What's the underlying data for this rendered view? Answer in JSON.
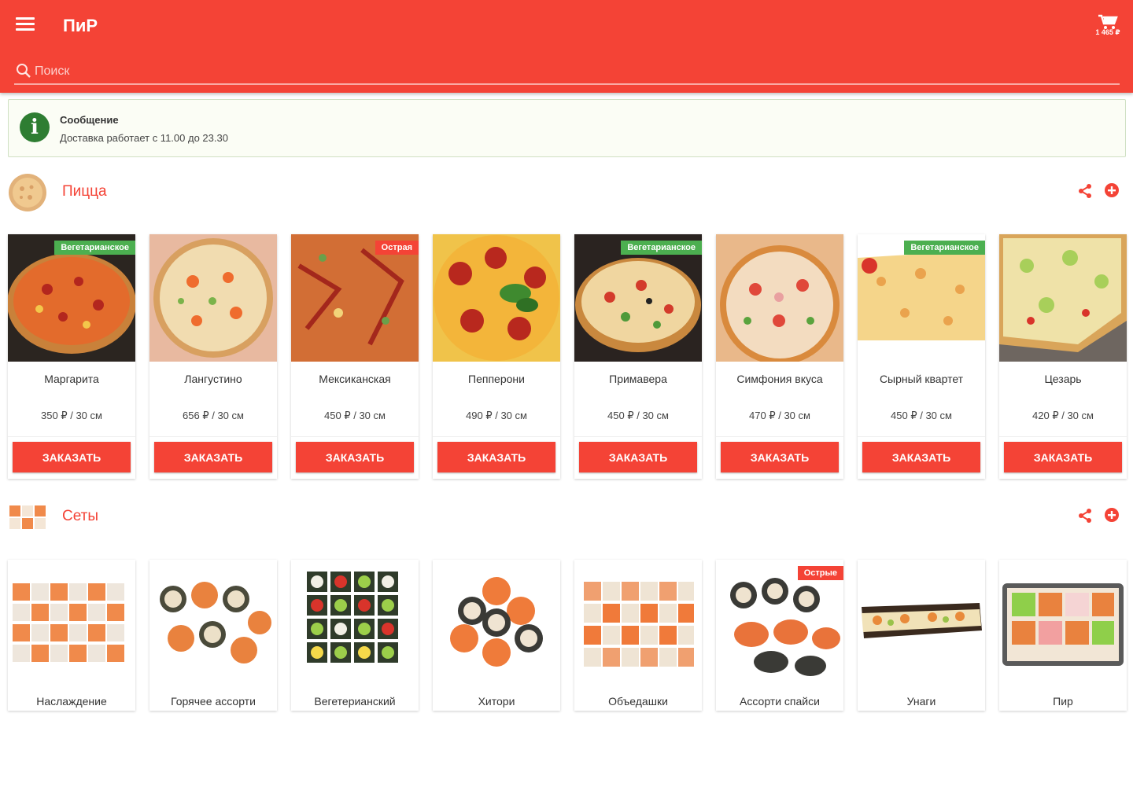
{
  "app": {
    "title": "ПиР",
    "cart_total": "1 465 ₽",
    "accent": "#f44336"
  },
  "search": {
    "placeholder": "Поиск"
  },
  "message": {
    "title": "Сообщение",
    "text": "Доставка работает с 11.00 до 23.30"
  },
  "sections": [
    {
      "title": "Пицца",
      "items": [
        {
          "name": "Маргарита",
          "price": "350 ₽ / 30 см",
          "badge": "Вегетарианское",
          "badge_type": "veg"
        },
        {
          "name": "Лангустино",
          "price": "656 ₽ / 30 см",
          "badge": "",
          "badge_type": ""
        },
        {
          "name": "Мексиканская",
          "price": "450 ₽ / 30 см",
          "badge": "Острая",
          "badge_type": "hot"
        },
        {
          "name": "Пепперони",
          "price": "490 ₽ / 30 см",
          "badge": "",
          "badge_type": ""
        },
        {
          "name": "Примавера",
          "price": "450 ₽ / 30 см",
          "badge": "Вегетарианское",
          "badge_type": "veg"
        },
        {
          "name": "Симфония вкуса",
          "price": "470 ₽ / 30 см",
          "badge": "",
          "badge_type": ""
        },
        {
          "name": "Сырный квартет",
          "price": "450 ₽ / 30 см",
          "badge": "Вегетарианское",
          "badge_type": "veg"
        },
        {
          "name": "Цезарь",
          "price": "420 ₽ / 30 см",
          "badge": "",
          "badge_type": ""
        }
      ]
    },
    {
      "title": "Сеты",
      "items": [
        {
          "name": "Наслаждение",
          "badge": "",
          "badge_type": ""
        },
        {
          "name": "Горячее ассорти",
          "badge": "",
          "badge_type": ""
        },
        {
          "name": "Вегетерианский",
          "badge": "",
          "badge_type": ""
        },
        {
          "name": "Хитори",
          "badge": "",
          "badge_type": ""
        },
        {
          "name": "Объедашки",
          "badge": "",
          "badge_type": ""
        },
        {
          "name": "Ассорти спайси",
          "badge": "Острые",
          "badge_type": "hot"
        },
        {
          "name": "Унаги",
          "badge": "",
          "badge_type": ""
        },
        {
          "name": "Пир",
          "badge": "",
          "badge_type": ""
        }
      ]
    }
  ],
  "order_label": "ЗАКАЗАТЬ"
}
